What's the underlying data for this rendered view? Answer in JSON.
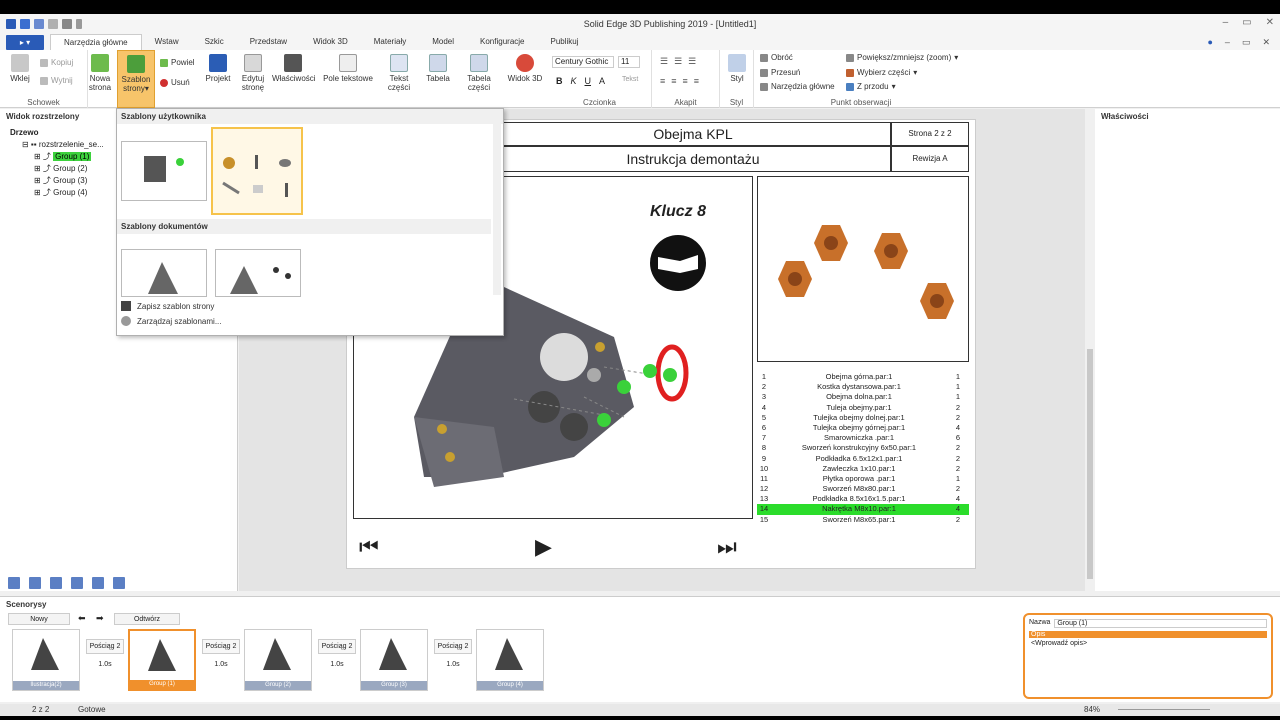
{
  "window": {
    "title": "Solid Edge 3D Publishing  2019 - [Untitled1]"
  },
  "tabs": [
    "Narzędzia główne",
    "Wstaw",
    "Szkic",
    "Przedstaw",
    "Widok 3D",
    "Materiały",
    "Model",
    "Konfiguracje",
    "Publikuj"
  ],
  "ribbon": {
    "clipboard": {
      "paste": "Wklej",
      "copy": "Kopiuj",
      "cut": "Wytnij",
      "label": "Schowek"
    },
    "new_page": "Nowa strona",
    "template": "Szablon strony",
    "repeat": "Powiel",
    "delete": "Usuń",
    "project": "Projekt",
    "edit_page": "Edytuj stronę",
    "properties": "Właściwości",
    "text_field": "Pole tekstowe",
    "part_text": "Tekst części",
    "table": "Tabela",
    "parts_table": "Tabela części",
    "view3d": "Widok 3D",
    "font": {
      "name": "Century Gothic",
      "size": "11",
      "text": "Tekst",
      "label": "Czcionka"
    },
    "paragraph": "Akapit",
    "style": "Styl",
    "styl_label": "Styl",
    "view": {
      "rotate": "Obróć",
      "pan": "Przesuń",
      "main_tools": "Narzędzia główne",
      "zoom": "Powiększ/zmniejsz (zoom)",
      "select_parts": "Wybierz części",
      "front": "Z przodu",
      "label": "Punkt obserwacji"
    }
  },
  "left_panel": {
    "title": "Widok rozstrzelony",
    "tree_label": "Drzewo",
    "root": "rozstrzelenie_se...",
    "groups": [
      "Group (1)",
      "Group (2)",
      "Group (3)",
      "Group (4)"
    ]
  },
  "right_panel": {
    "title": "Właściwości"
  },
  "dropdown": {
    "user_templates": "Szablony użytkownika",
    "doc_templates": "Szablony dokumentów",
    "save": "Zapisz szablon strony",
    "manage": "Zarządzaj szablonami..."
  },
  "page": {
    "title": "Obejma KPL",
    "subtitle": "Instrukcja demontażu",
    "page_no": "Strona 2 z 2",
    "revision": "Rewizja A",
    "tool_label": "Klucz 8"
  },
  "bom": [
    [
      "1",
      "Obejma górna.par:1",
      "1"
    ],
    [
      "2",
      "Kostka dystansowa.par:1",
      "1"
    ],
    [
      "3",
      "Obejma dolna.par:1",
      "1"
    ],
    [
      "4",
      "Tuleja obejmy.par:1",
      "2"
    ],
    [
      "5",
      "Tulejka obejmy dolnej.par:1",
      "2"
    ],
    [
      "6",
      "Tulejka obejmy górnej.par:1",
      "4"
    ],
    [
      "7",
      "Smarowniczka .par:1",
      "6"
    ],
    [
      "8",
      "Sworzeń konstrukcyjny 6x50.par:1",
      "2"
    ],
    [
      "9",
      "Podkładka 6.5x12x1.par:1",
      "2"
    ],
    [
      "10",
      "Zawleczka 1x10.par:1",
      "2"
    ],
    [
      "11",
      "Płytka oporowa .par:1",
      "1"
    ],
    [
      "12",
      "Sworzeń M8x80.par:1",
      "2"
    ],
    [
      "13",
      "Podkładka 8.5x16x1.5.par:1",
      "4"
    ],
    [
      "14",
      "Nakrętka M8x10.par:1",
      "4"
    ],
    [
      "15",
      "Sworzeń M8x65.par:1",
      "2"
    ]
  ],
  "scenarios": {
    "title": "Scenorysy",
    "new": "Nowy",
    "play": "Odtwórz",
    "frames": [
      {
        "label": "Ilustracja(2)",
        "time": "1.0s"
      },
      {
        "label": "Group (1)",
        "time": "1.0s"
      },
      {
        "label": "Group (2)",
        "time": "1.0s"
      },
      {
        "label": "Group (3)",
        "time": "1.0s"
      },
      {
        "label": "Group (4)",
        "time": "1.0s"
      }
    ],
    "transitions": [
      {
        "label": "Pościąg 2",
        "time": "1.0s"
      },
      {
        "label": "Pościąg 2",
        "time": "1.0s"
      },
      {
        "label": "Pościąg 2",
        "time": "1.0s"
      },
      {
        "label": "Pościąg 2",
        "time": "1.0s"
      }
    ],
    "props": {
      "name_label": "Nazwa",
      "name_value": "Group (1)",
      "desc_label": "Opis",
      "desc_value": "<Wprowadź opis>"
    }
  },
  "status": {
    "page": "2 z 2",
    "state": "Gotowe",
    "zoom": "84%"
  }
}
